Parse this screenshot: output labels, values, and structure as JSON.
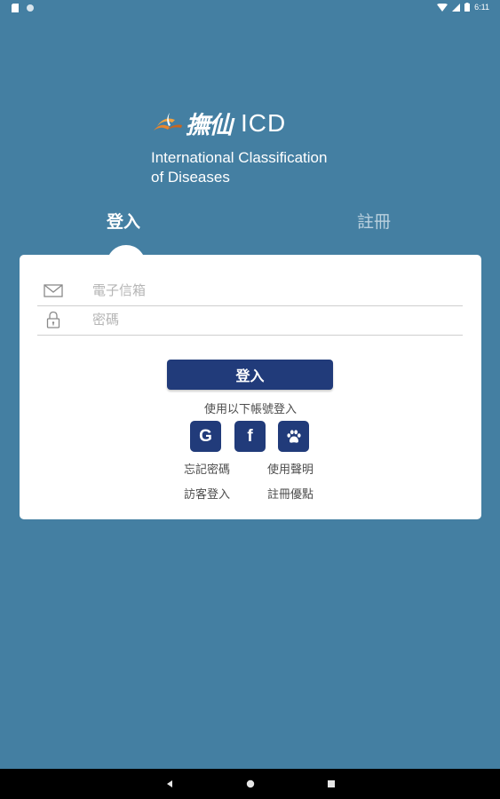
{
  "status_bar": {
    "time": "6:11"
  },
  "logo": {
    "brand": "撫仙",
    "title": "ICD",
    "subtitle_line1": "International Classification",
    "subtitle_line2": "of Diseases"
  },
  "tabs": [
    {
      "label": "登入",
      "active": true
    },
    {
      "label": "註冊",
      "active": false
    }
  ],
  "form": {
    "email": {
      "placeholder": "電子信箱",
      "value": ""
    },
    "password": {
      "placeholder": "密碼",
      "value": ""
    },
    "login_button": "登入",
    "alt_login_text": "使用以下帳號登入",
    "social": [
      {
        "name": "google",
        "glyph": "G"
      },
      {
        "name": "facebook",
        "glyph": "f"
      },
      {
        "name": "paw",
        "glyph": ""
      }
    ],
    "links": {
      "forgot_password": "忘記密碼",
      "terms": "使用聲明",
      "guest_login": "訪客登入",
      "register_benefits": "註冊優點"
    }
  },
  "colors": {
    "background": "#447fa2",
    "primary": "#213b7a",
    "card": "#ffffff",
    "logo_accent": "#e8852d"
  }
}
